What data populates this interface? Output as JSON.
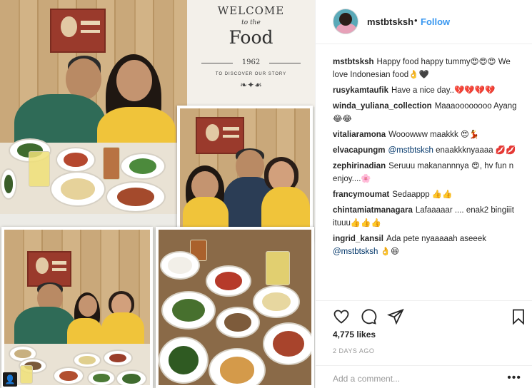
{
  "post": {
    "collage": {
      "welcome_line1": "WELCOME",
      "welcome_line2": "to the",
      "welcome_line3": "Food",
      "welcome_year": "1962",
      "welcome_tagline": "TO DISCOVER OUR STORY"
    },
    "header": {
      "username": "mstbtsksh",
      "separator": "•",
      "follow_label": "Follow"
    },
    "comments": [
      {
        "user": "mstbtsksh",
        "text": "Happy food happy tummy😍😍😍 We love Indonesian food👌🖤"
      },
      {
        "user": "rusykamtaufik",
        "text": "Have a nice day..💔💔💔💔"
      },
      {
        "user": "winda_yuliana_collection",
        "text": "Maaaoooooooo Ayang😂😂"
      },
      {
        "user": "vitaliaramona",
        "text": "Wooowww maakkk 😍💃"
      },
      {
        "user": "elvacapungm",
        "mention": "@mstbtsksh",
        "text": "enaakkknyaaaa 💋💋"
      },
      {
        "user": "zephirinadian",
        "text": "Seruuu makanannnya 😍, hv fun n enjoy....🌸"
      },
      {
        "user": "francymoumat",
        "text": "Sedaappp 👍👍"
      },
      {
        "user": "chintamiatmanagara",
        "text": "Lafaaaaar .... enak2 bingiiit ituuu👍👍👍"
      },
      {
        "user": "ingrid_kansil",
        "text": "Ada pete nyaaaaah aseeek",
        "mention_after": "@mstbtsksh",
        "text_after": "👌😆"
      }
    ],
    "likes_text": "4,775 likes",
    "date_text": "2 DAYS AGO",
    "add_comment_placeholder": "Add a comment...",
    "more_label": "•••",
    "icons": {
      "like": "heart-icon",
      "comment": "comment-icon",
      "share": "share-icon",
      "save": "bookmark-icon",
      "more": "more-options-icon",
      "user_tag": "user-tag-icon"
    },
    "colors": {
      "follow": "#3897f0",
      "mention": "#003569",
      "muted": "#999999"
    }
  }
}
